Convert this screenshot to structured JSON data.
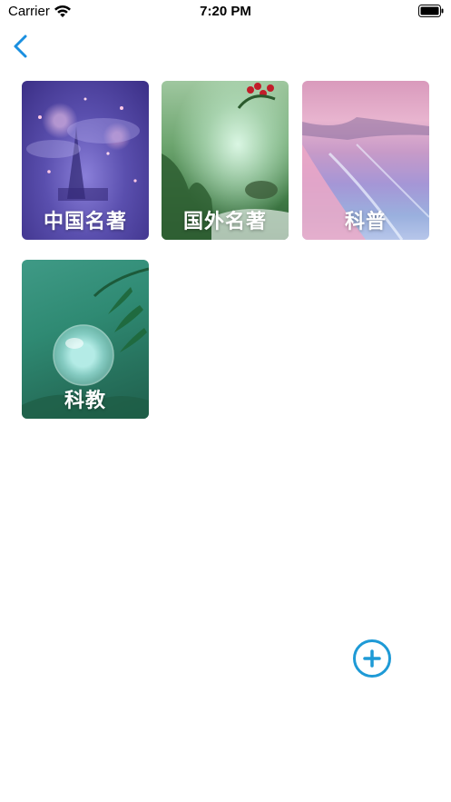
{
  "status_bar": {
    "carrier": "Carrier",
    "time": "7:20 PM",
    "wifi_icon": "wifi-icon",
    "battery_icon": "battery-icon"
  },
  "nav": {
    "back_icon": "chevron-left-icon"
  },
  "categories": [
    {
      "label": "中国名著"
    },
    {
      "label": "国外名著"
    },
    {
      "label": "科普"
    },
    {
      "label": "科教"
    }
  ],
  "fab": {
    "icon": "plus-circle-icon"
  },
  "colors": {
    "accent": "#1a8fe0",
    "fab": "#1e9ad6",
    "background": "#ffffff"
  }
}
